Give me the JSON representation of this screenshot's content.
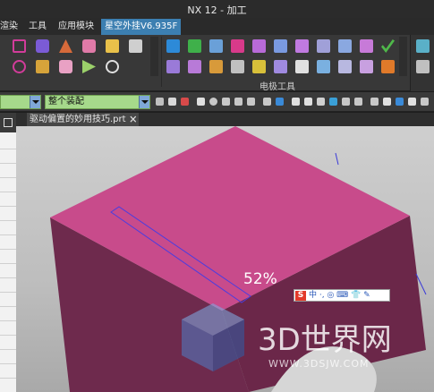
{
  "window": {
    "title": "NX 12 - 加工"
  },
  "menubar": {
    "items": [
      "渲染",
      "工具",
      "应用模块"
    ],
    "active_tab": "星空外挂V6.935F"
  },
  "ribbon": {
    "group_label": "电极工具"
  },
  "toolbar": {
    "filter_combo": "",
    "assembly_combo": "整个装配"
  },
  "document_tab": {
    "label": "驱动偏置的妙用技巧.prt",
    "close": "🗙"
  },
  "viewport": {
    "progress_text": "52%"
  },
  "ime": {
    "logo": "S",
    "glyphs": "中 ·, ◎ ⌨ 👕 ✎"
  },
  "watermark": {
    "brand": "3D世界网",
    "url": "WWW.3DSJW.COM"
  },
  "colors": {
    "part_top": "#c84b8b",
    "part_side": "#6e2a4d",
    "accent": "#3c7fb1"
  }
}
